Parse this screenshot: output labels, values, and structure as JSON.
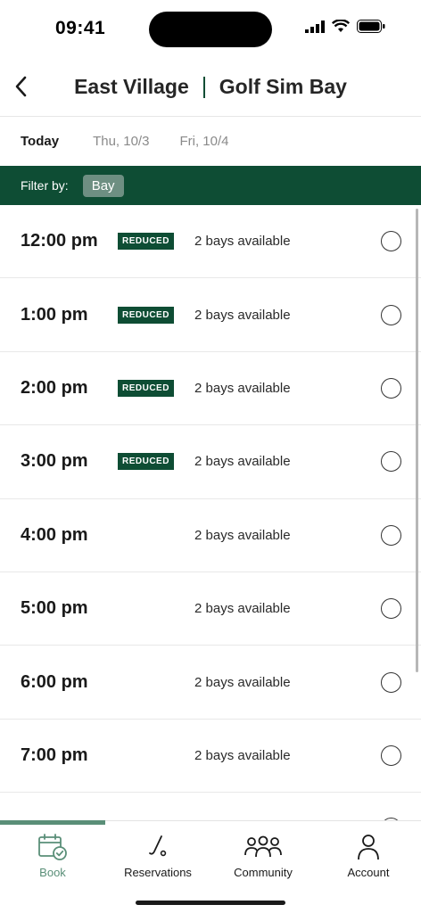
{
  "status_bar": {
    "time": "09:41"
  },
  "header": {
    "location": "East Village",
    "title": "Golf Sim Bay"
  },
  "date_tabs": [
    {
      "label": "Today",
      "active": true
    },
    {
      "label": "Thu, 10/3",
      "active": false
    },
    {
      "label": "Fri, 10/4",
      "active": false
    }
  ],
  "filter": {
    "label": "Filter by:",
    "chip": "Bay"
  },
  "slots": [
    {
      "time": "12:00 pm",
      "badge": "REDUCED",
      "availability": "2 bays available"
    },
    {
      "time": "1:00 pm",
      "badge": "REDUCED",
      "availability": "2 bays available"
    },
    {
      "time": "2:00 pm",
      "badge": "REDUCED",
      "availability": "2 bays available"
    },
    {
      "time": "3:00 pm",
      "badge": "REDUCED",
      "availability": "2 bays available"
    },
    {
      "time": "4:00 pm",
      "badge": "",
      "availability": "2 bays available"
    },
    {
      "time": "5:00 pm",
      "badge": "",
      "availability": "2 bays available"
    },
    {
      "time": "6:00 pm",
      "badge": "",
      "availability": "2 bays available"
    },
    {
      "time": "7:00 pm",
      "badge": "",
      "availability": "2 bays available"
    },
    {
      "time": "",
      "badge": "",
      "availability": ""
    }
  ],
  "nav": [
    {
      "label": "Book",
      "icon": "calendar-check-icon",
      "active": true
    },
    {
      "label": "Reservations",
      "icon": "golf-club-icon",
      "active": false
    },
    {
      "label": "Community",
      "icon": "people-icon",
      "active": false
    },
    {
      "label": "Account",
      "icon": "person-icon",
      "active": false
    }
  ],
  "colors": {
    "brand_green": "#0e4d34",
    "active_nav": "#5a8f78"
  }
}
